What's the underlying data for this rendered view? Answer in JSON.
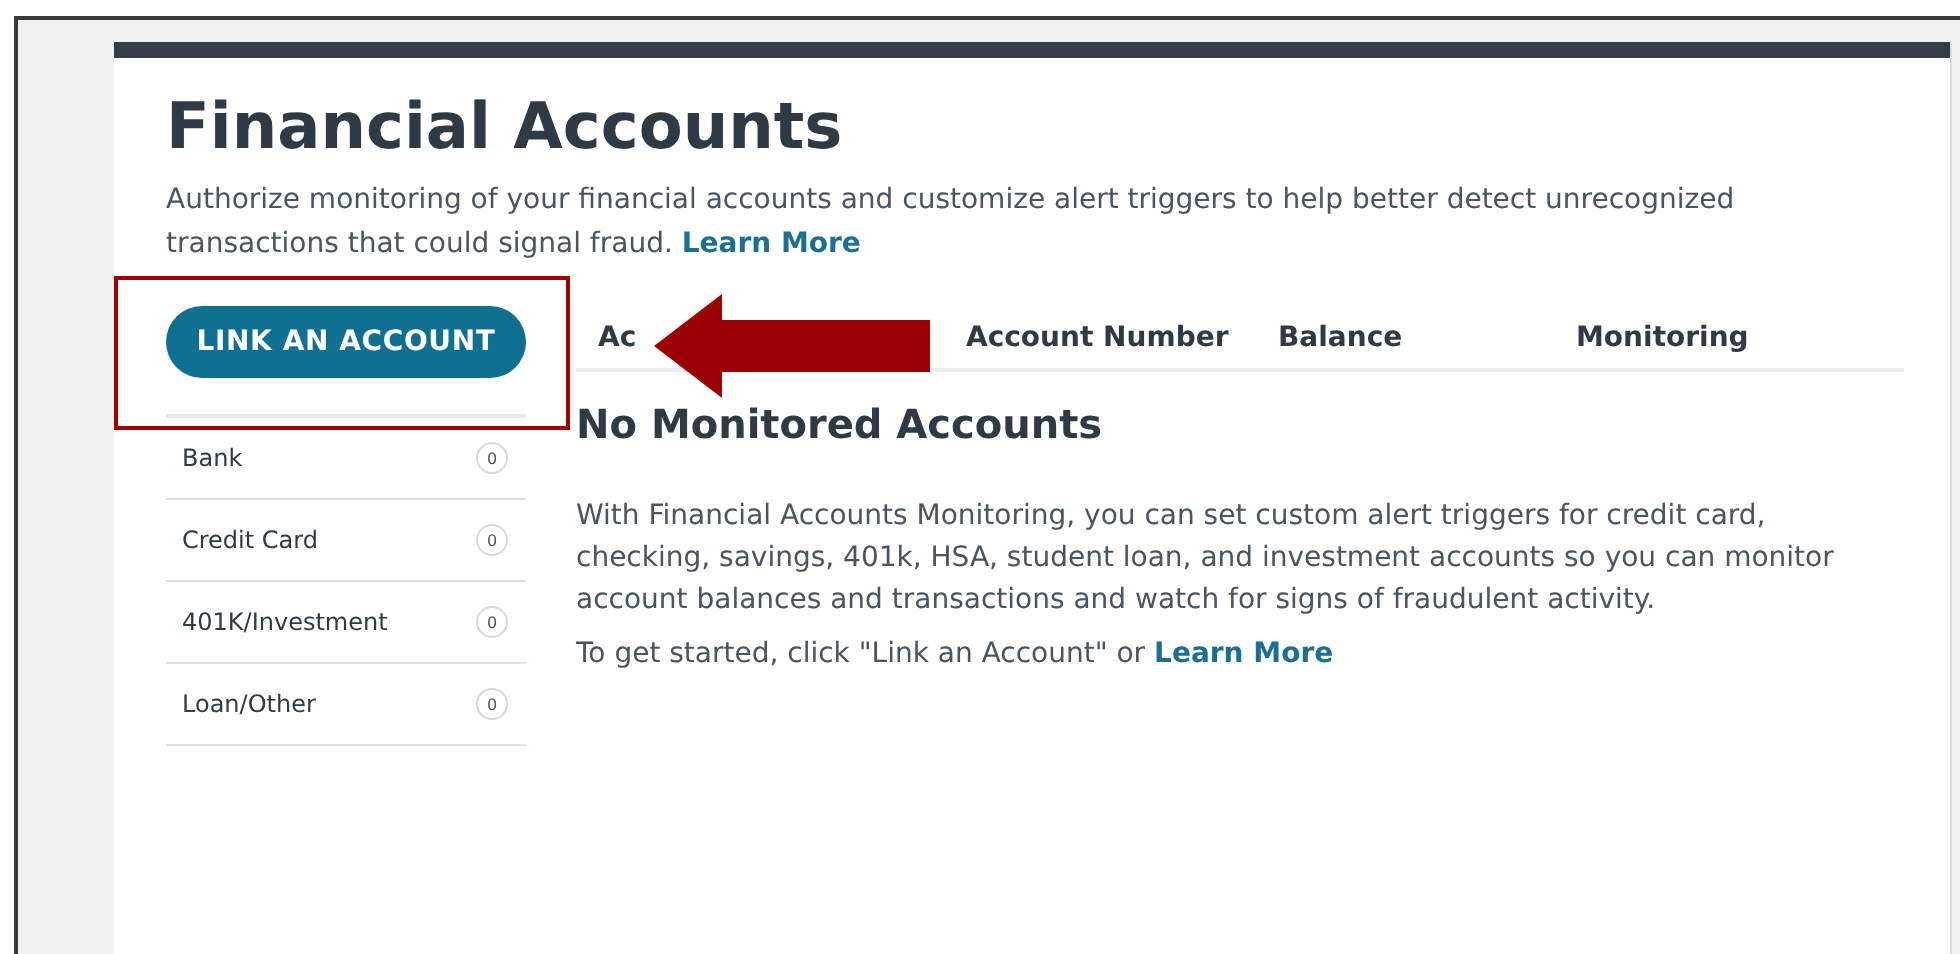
{
  "page": {
    "title": "Financial Accounts",
    "description": "Authorize monitoring of your financial accounts and customize alert triggers to help better detect unrecognized transactions that could signal fraud.",
    "description_link": "Learn More"
  },
  "link_button": {
    "label": "LINK AN ACCOUNT"
  },
  "categories": [
    {
      "label": "Bank",
      "count": "0"
    },
    {
      "label": "Credit Card",
      "count": "0"
    },
    {
      "label": "401K/Investment",
      "count": "0"
    },
    {
      "label": "Loan/Other",
      "count": "0"
    }
  ],
  "table": {
    "columns": [
      "Ac",
      "Account Number",
      "Balance",
      "Monitoring"
    ]
  },
  "empty_state": {
    "title": "No Monitored Accounts",
    "body": "With Financial Accounts Monitoring, you can set custom alert triggers for credit card, checking, savings, 401k, HSA, student loan, and investment accounts so you can monitor account balances and transactions and watch for signs of fraudulent activity.",
    "prompt": "To get started, click \"Link an Account\" or",
    "prompt_link": "Learn More"
  }
}
